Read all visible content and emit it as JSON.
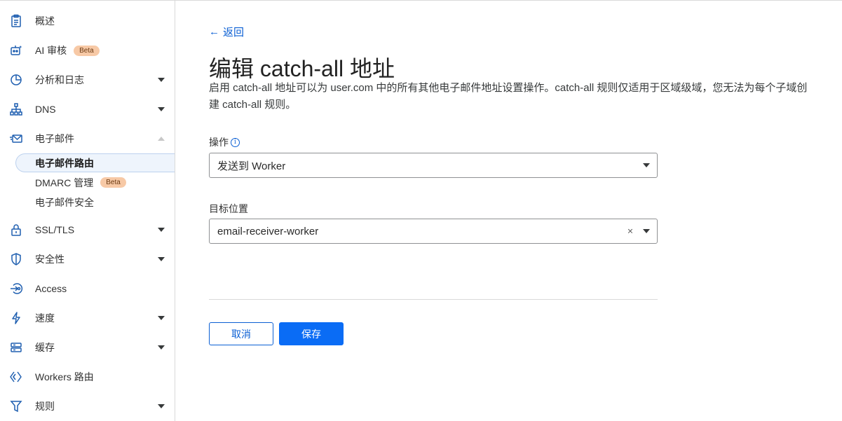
{
  "sidebar": {
    "items": [
      {
        "label": "概述",
        "icon": "clipboard-icon"
      },
      {
        "label": "AI 审核",
        "icon": "robot-icon",
        "badge": "Beta"
      },
      {
        "label": "分析和日志",
        "icon": "pie-chart-icon"
      },
      {
        "label": "DNS",
        "icon": "network-icon"
      },
      {
        "label": "电子邮件",
        "icon": "email-icon"
      },
      {
        "label": "SSL/TLS",
        "icon": "lock-icon"
      },
      {
        "label": "安全性",
        "icon": "shield-icon"
      },
      {
        "label": "Access",
        "icon": "access-icon"
      },
      {
        "label": "速度",
        "icon": "lightning-icon"
      },
      {
        "label": "缓存",
        "icon": "storage-icon"
      },
      {
        "label": "Workers 路由",
        "icon": "workers-icon"
      },
      {
        "label": "规则",
        "icon": "rules-icon"
      }
    ],
    "email_sub": [
      {
        "label": "电子邮件路由",
        "active": true
      },
      {
        "label": "DMARC 管理",
        "badge": "Beta"
      },
      {
        "label": "电子邮件安全"
      }
    ]
  },
  "main": {
    "back_label": "返回",
    "title": "编辑 catch-all 地址",
    "description": "启用 catch-all 地址可以为 user.com 中的所有其他电子邮件地址设置操作。catch-all 规则仅适用于区域级域，您无法为每个子域创建 catch-all 规则。",
    "action_label": "操作",
    "action_value": "发送到 Worker",
    "destination_label": "目标位置",
    "destination_value": "email-receiver-worker",
    "cancel_label": "取消",
    "save_label": "保存"
  },
  "colors": {
    "accent": "#0a6cf5",
    "link": "#0a5fd4",
    "icon": "#1f5fb0",
    "badge_bg": "#f7c9a6"
  }
}
